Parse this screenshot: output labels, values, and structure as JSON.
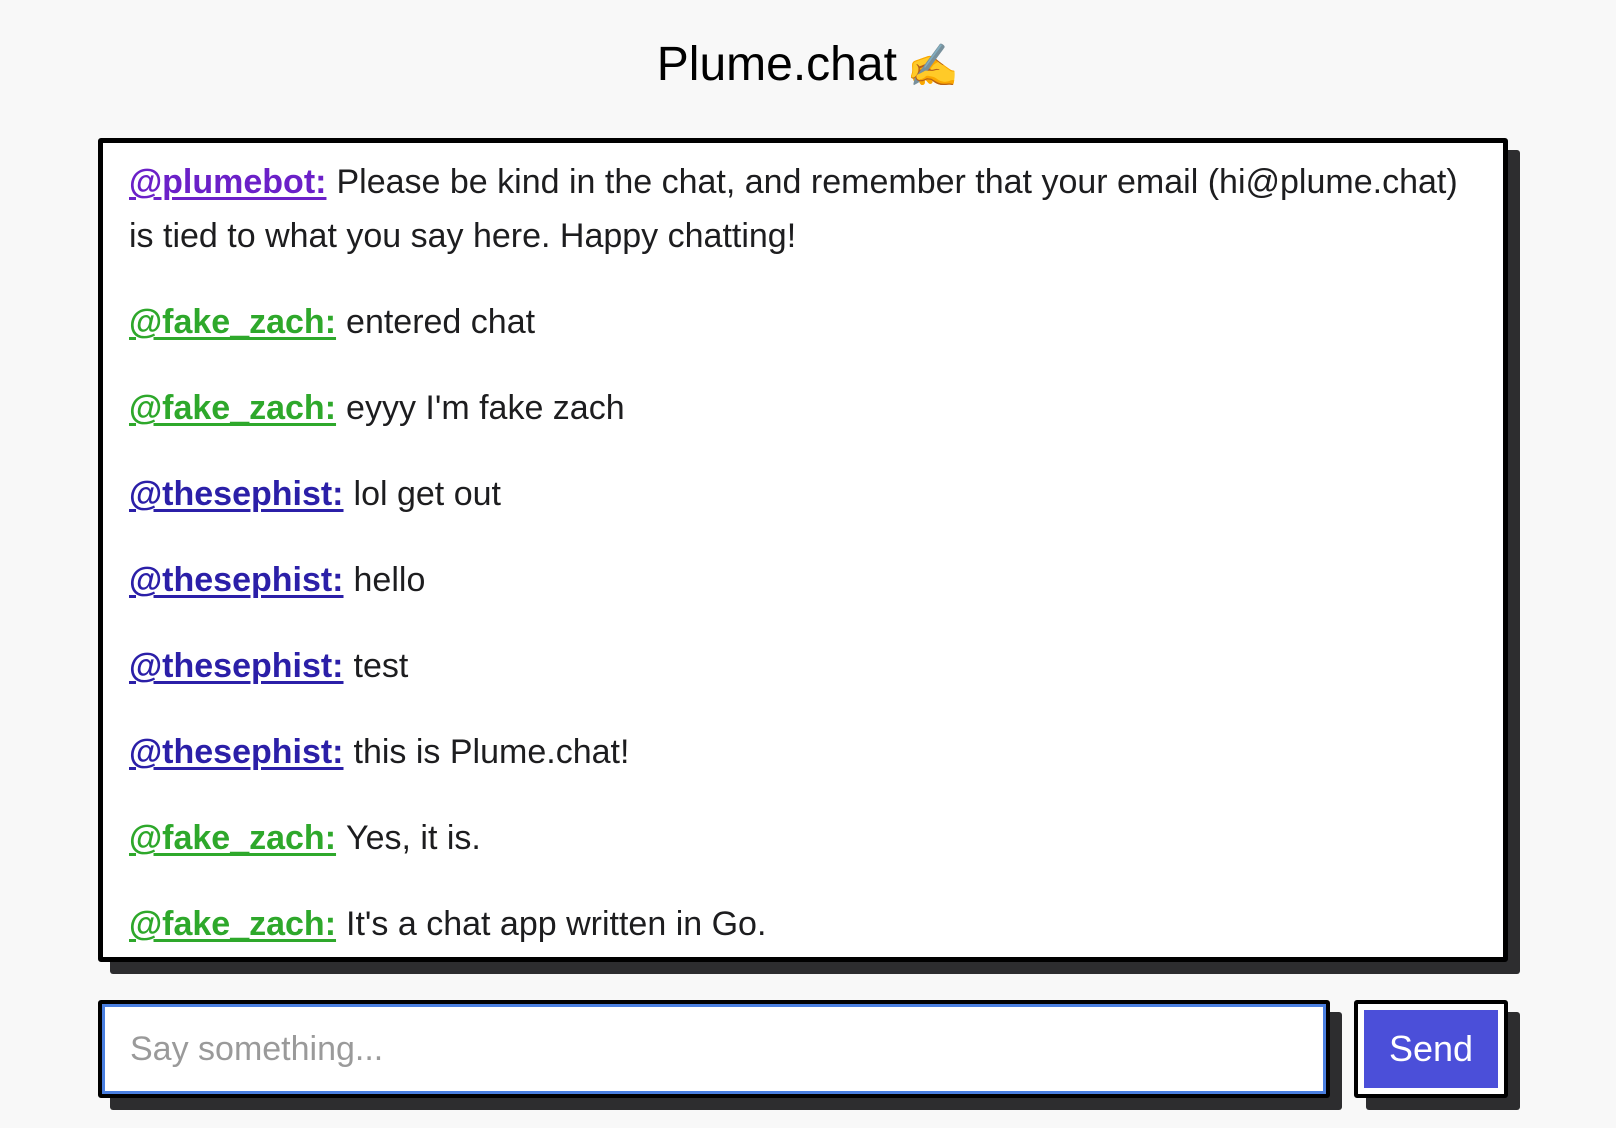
{
  "header": {
    "title": "Plume.chat",
    "emoji": "✍️"
  },
  "messages": [
    {
      "author": "@plumebot:",
      "author_id": "plumebot",
      "text": "Please be kind in the chat, and remember that your email (hi@plume.chat) is tied to what you say here. Happy chatting!"
    },
    {
      "author": "@fake_zach:",
      "author_id": "fake_zach",
      "text": "entered chat"
    },
    {
      "author": "@fake_zach:",
      "author_id": "fake_zach",
      "text": "eyyy I'm fake zach"
    },
    {
      "author": "@thesephist:",
      "author_id": "thesephist",
      "text": "lol get out"
    },
    {
      "author": "@thesephist:",
      "author_id": "thesephist",
      "text": "hello"
    },
    {
      "author": "@thesephist:",
      "author_id": "thesephist",
      "text": "test"
    },
    {
      "author": "@thesephist:",
      "author_id": "thesephist",
      "text": "this is Plume.chat!"
    },
    {
      "author": "@fake_zach:",
      "author_id": "fake_zach",
      "text": "Yes, it is."
    },
    {
      "author": "@fake_zach:",
      "author_id": "fake_zach",
      "text": "It's a chat app written in Go."
    }
  ],
  "composer": {
    "placeholder": "Say something...",
    "value": "",
    "send_label": "Send"
  },
  "colors": {
    "plumebot": "#6b20c8",
    "fake_zach": "#2ea82b",
    "thesephist": "#2b1fa8",
    "send_button": "#4b4fd9",
    "input_focus": "#4a7fe0"
  }
}
